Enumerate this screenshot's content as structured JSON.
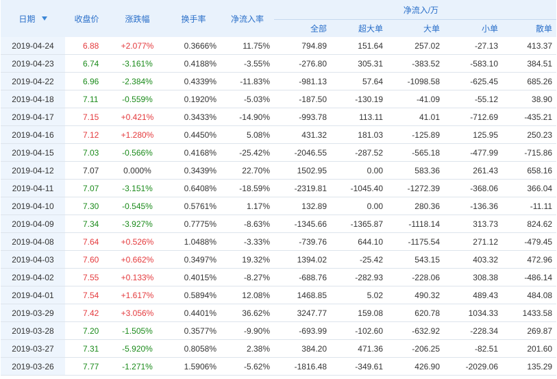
{
  "headers": {
    "date": "日期",
    "close": "收盘价",
    "change_pct": "涨跌幅",
    "turnover": "换手率",
    "net_inflow_rate": "净流入率",
    "net_inflow_group": "净流入/万",
    "all": "全部",
    "super_large": "超大单",
    "large": "大单",
    "small": "小单",
    "retail": "散单"
  },
  "colors": {
    "up": "#e4393c",
    "down": "#1a8a1a",
    "header_text": "#2a6fc9",
    "header_bg": "#e9f2fc"
  },
  "icons": {
    "sort": "sort-down-arrow-icon"
  },
  "rows": [
    {
      "date": "2019-04-24",
      "close": "6.88",
      "change": "+2.077%",
      "trend": "up",
      "turnover": "0.3666%",
      "rate": "11.75%",
      "all": "794.89",
      "super": "151.64",
      "large": "257.02",
      "small": "-27.13",
      "retail": "413.37"
    },
    {
      "date": "2019-04-23",
      "close": "6.74",
      "change": "-3.161%",
      "trend": "down",
      "turnover": "0.4188%",
      "rate": "-3.55%",
      "all": "-276.80",
      "super": "305.31",
      "large": "-383.52",
      "small": "-583.10",
      "retail": "384.51"
    },
    {
      "date": "2019-04-22",
      "close": "6.96",
      "change": "-2.384%",
      "trend": "down",
      "turnover": "0.4339%",
      "rate": "-11.83%",
      "all": "-981.13",
      "super": "57.64",
      "large": "-1098.58",
      "small": "-625.45",
      "retail": "685.26"
    },
    {
      "date": "2019-04-18",
      "close": "7.11",
      "change": "-0.559%",
      "trend": "down",
      "turnover": "0.1920%",
      "rate": "-5.03%",
      "all": "-187.50",
      "super": "-130.19",
      "large": "-41.09",
      "small": "-55.12",
      "retail": "38.90"
    },
    {
      "date": "2019-04-17",
      "close": "7.15",
      "change": "+0.421%",
      "trend": "up",
      "turnover": "0.3433%",
      "rate": "-14.90%",
      "all": "-993.78",
      "super": "113.11",
      "large": "41.01",
      "small": "-712.69",
      "retail": "-435.21"
    },
    {
      "date": "2019-04-16",
      "close": "7.12",
      "change": "+1.280%",
      "trend": "up",
      "turnover": "0.4450%",
      "rate": "5.08%",
      "all": "431.32",
      "super": "181.03",
      "large": "-125.89",
      "small": "125.95",
      "retail": "250.23"
    },
    {
      "date": "2019-04-15",
      "close": "7.03",
      "change": "-0.566%",
      "trend": "down",
      "turnover": "0.4168%",
      "rate": "-25.42%",
      "all": "-2046.55",
      "super": "-287.52",
      "large": "-565.18",
      "small": "-477.99",
      "retail": "-715.86"
    },
    {
      "date": "2019-04-12",
      "close": "7.07",
      "change": "0.000%",
      "trend": "flat",
      "turnover": "0.3439%",
      "rate": "22.70%",
      "all": "1502.95",
      "super": "0.00",
      "large": "583.36",
      "small": "261.43",
      "retail": "658.16"
    },
    {
      "date": "2019-04-11",
      "close": "7.07",
      "change": "-3.151%",
      "trend": "down",
      "turnover": "0.6408%",
      "rate": "-18.59%",
      "all": "-2319.81",
      "super": "-1045.40",
      "large": "-1272.39",
      "small": "-368.06",
      "retail": "366.04"
    },
    {
      "date": "2019-04-10",
      "close": "7.30",
      "change": "-0.545%",
      "trend": "down",
      "turnover": "0.5761%",
      "rate": "1.17%",
      "all": "132.89",
      "super": "0.00",
      "large": "280.36",
      "small": "-136.36",
      "retail": "-11.11"
    },
    {
      "date": "2019-04-09",
      "close": "7.34",
      "change": "-3.927%",
      "trend": "down",
      "turnover": "0.7775%",
      "rate": "-8.63%",
      "all": "-1345.66",
      "super": "-1365.87",
      "large": "-1118.14",
      "small": "313.73",
      "retail": "824.62"
    },
    {
      "date": "2019-04-08",
      "close": "7.64",
      "change": "+0.526%",
      "trend": "up",
      "turnover": "1.0488%",
      "rate": "-3.33%",
      "all": "-739.76",
      "super": "644.10",
      "large": "-1175.54",
      "small": "271.12",
      "retail": "-479.45"
    },
    {
      "date": "2019-04-03",
      "close": "7.60",
      "change": "+0.662%",
      "trend": "up",
      "turnover": "0.3497%",
      "rate": "19.32%",
      "all": "1394.02",
      "super": "-25.42",
      "large": "543.15",
      "small": "403.32",
      "retail": "472.96"
    },
    {
      "date": "2019-04-02",
      "close": "7.55",
      "change": "+0.133%",
      "trend": "up",
      "turnover": "0.4015%",
      "rate": "-8.27%",
      "all": "-688.76",
      "super": "-282.93",
      "large": "-228.06",
      "small": "308.38",
      "retail": "-486.14"
    },
    {
      "date": "2019-04-01",
      "close": "7.54",
      "change": "+1.617%",
      "trend": "up",
      "turnover": "0.5894%",
      "rate": "12.08%",
      "all": "1468.85",
      "super": "5.02",
      "large": "490.32",
      "small": "489.43",
      "retail": "484.08"
    },
    {
      "date": "2019-03-29",
      "close": "7.42",
      "change": "+3.056%",
      "trend": "up",
      "turnover": "0.4401%",
      "rate": "36.62%",
      "all": "3247.77",
      "super": "159.08",
      "large": "620.78",
      "small": "1034.33",
      "retail": "1433.58"
    },
    {
      "date": "2019-03-28",
      "close": "7.20",
      "change": "-1.505%",
      "trend": "down",
      "turnover": "0.3577%",
      "rate": "-9.90%",
      "all": "-693.99",
      "super": "-102.60",
      "large": "-632.92",
      "small": "-228.34",
      "retail": "269.87"
    },
    {
      "date": "2019-03-27",
      "close": "7.31",
      "change": "-5.920%",
      "trend": "down",
      "turnover": "0.8058%",
      "rate": "2.38%",
      "all": "384.20",
      "super": "471.36",
      "large": "-206.25",
      "small": "-82.51",
      "retail": "201.60"
    },
    {
      "date": "2019-03-26",
      "close": "7.77",
      "change": "-1.271%",
      "trend": "down",
      "turnover": "1.5906%",
      "rate": "-5.62%",
      "all": "-1816.48",
      "super": "-349.61",
      "large": "426.90",
      "small": "-2029.06",
      "retail": "135.29"
    }
  ]
}
